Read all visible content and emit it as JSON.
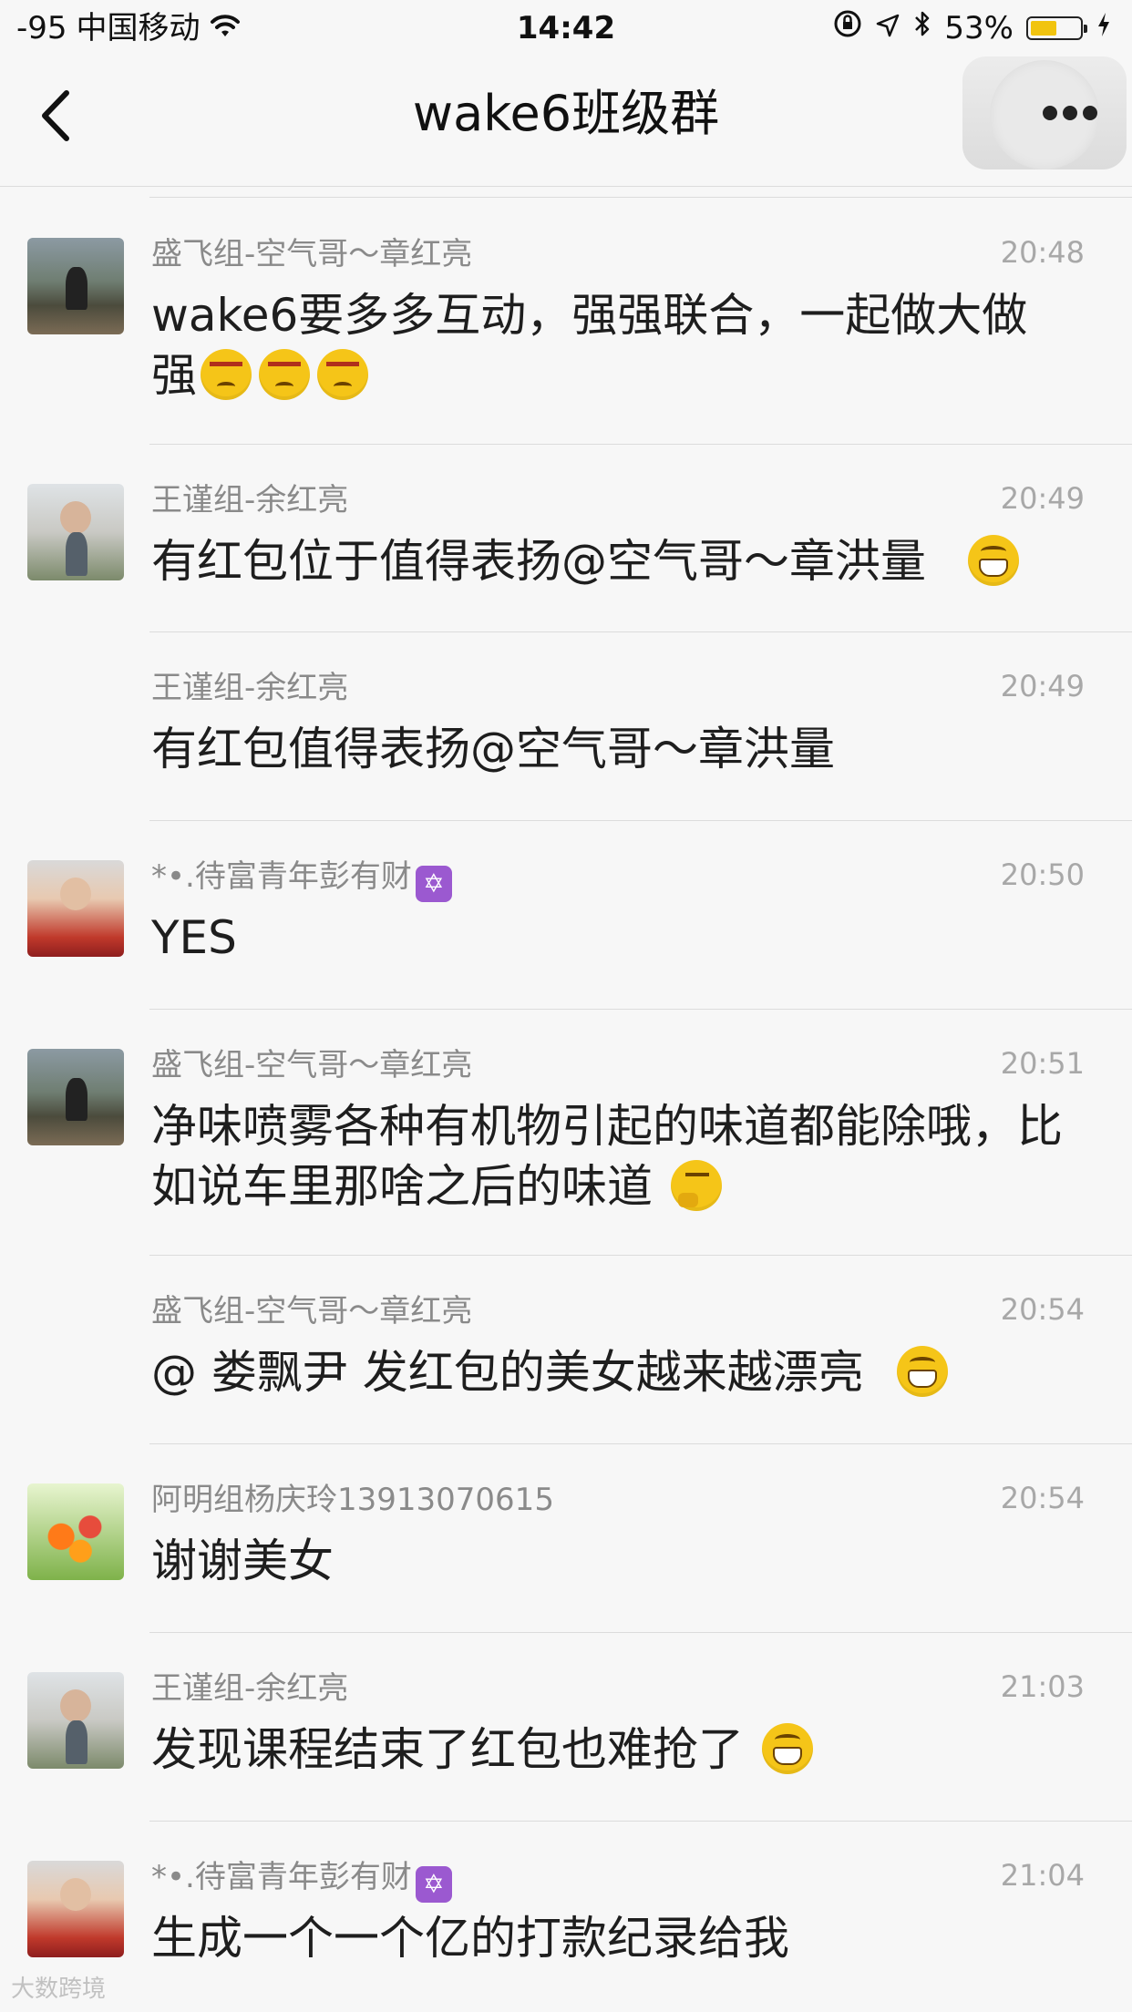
{
  "status_bar": {
    "signal": "-95",
    "carrier": "中国移动",
    "time": "14:42",
    "battery_percent": "53%",
    "battery_level": 0.53
  },
  "nav": {
    "title": "wake6班级群"
  },
  "messages": [
    {
      "sender": "盛飞组-空气哥～章红亮",
      "time": "20:48",
      "text": "wake6要多多互动，强强联合，一起做大做强",
      "emoji": [
        "angry",
        "angry",
        "angry"
      ],
      "avatar": "outdoor-photo"
    },
    {
      "sender": "王谨组-余红亮",
      "time": "20:49",
      "text": "有红包位于值得表扬@空气哥～章洪量",
      "emoji": [
        "grin"
      ],
      "avatar": "person-photo"
    },
    {
      "sender": "王谨组-余红亮",
      "time": "20:49",
      "text": "有红包值得表扬@空气哥～章洪量",
      "emoji": [],
      "avatar": ""
    },
    {
      "sender": "*•.待富青年彭有财",
      "badge": "✡",
      "time": "20:50",
      "text": "YES",
      "emoji": [],
      "avatar": "selfie-photo"
    },
    {
      "sender": "盛飞组-空气哥～章红亮",
      "time": "20:51",
      "text": "净味喷雾各种有机物引起的味道都能除哦，比如说车里那啥之后的味道",
      "emoji": [
        "think"
      ],
      "avatar": "outdoor-photo"
    },
    {
      "sender": "盛飞组-空气哥～章红亮",
      "time": "20:54",
      "text": "@ 娄飘尹 发红包的美女越来越漂亮",
      "emoji": [
        "grin"
      ],
      "avatar": ""
    },
    {
      "sender": "阿明组杨庆玲13913070615",
      "time": "20:54",
      "text": "谢谢美女",
      "emoji": [],
      "avatar": "flowers-image"
    },
    {
      "sender": "王谨组-余红亮",
      "time": "21:03",
      "text": "发现课程结束了红包也难抢了",
      "emoji": [
        "grin"
      ],
      "avatar": "person-photo"
    },
    {
      "sender": "*•.待富青年彭有财",
      "badge": "✡",
      "time": "21:04",
      "text": "生成一个一个亿的打款纪录给我",
      "emoji": [],
      "avatar": "selfie-photo"
    }
  ],
  "watermark": "大数跨境",
  "icons": {
    "back": "chevron-left-icon",
    "more": "more-dots-icon",
    "wifi": "wifi-icon",
    "lock": "rotation-lock-icon",
    "location": "location-arrow-icon",
    "bluetooth": "bluetooth-icon",
    "battery": "battery-icon",
    "charging": "charging-bolt-icon"
  },
  "colors": {
    "background": "#f7f7f7",
    "sender_text": "#8a8a8a",
    "time_text": "#a8a8a8",
    "battery_fill": "#f1c40f"
  }
}
